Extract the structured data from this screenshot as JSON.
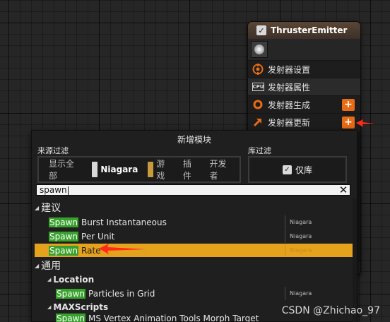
{
  "node": {
    "title": "ThrusterEmitter",
    "enabled_check": "✓",
    "rows": [
      {
        "label": "发射器设置",
        "icon": "emitter-settings-icon",
        "badge": "",
        "has_plus": false
      },
      {
        "label": "发射器属性",
        "icon": "cpu-icon",
        "badge": "CPU",
        "has_plus": false
      },
      {
        "label": "发射器生成",
        "icon": "orange-ring-icon",
        "badge": "",
        "has_plus": true
      },
      {
        "label": "发射器更新",
        "icon": "orange-arrow-icon",
        "badge": "",
        "has_plus": true
      }
    ],
    "plus_glyph": "+"
  },
  "popup": {
    "title": "新增模块",
    "source_filter": {
      "label": "来源过滤",
      "options": [
        {
          "label": "显示全部",
          "active": false,
          "swatch": ""
        },
        {
          "label": "Niagara",
          "active": true,
          "swatch": "#d8d8d8"
        },
        {
          "label": "游戏",
          "active": false,
          "swatch": "#c79a3c"
        },
        {
          "label": "插件",
          "active": false,
          "swatch": ""
        },
        {
          "label": "开发者",
          "active": false,
          "swatch": ""
        }
      ]
    },
    "library_filter": {
      "label": "库过滤",
      "check": "✓",
      "option": "仅库"
    },
    "search": {
      "value": "spawn",
      "clear_glyph": "✕"
    },
    "list": {
      "categories": [
        {
          "name": "建议",
          "items": [
            {
              "match": "Spawn",
              "rest": " Burst Instantaneous",
              "source": "Niagara",
              "selected": false
            },
            {
              "match": "Spawn",
              "rest": " Per Unit",
              "source": "Niagara",
              "selected": false
            },
            {
              "match": "Spawn",
              "rest": " Rate",
              "source": "Niagara",
              "selected": true
            }
          ]
        },
        {
          "name": "通用",
          "subgroups": [
            {
              "name": "Location",
              "items": [
                {
                  "match": "Spawn",
                  "rest": " Particles in Grid",
                  "source": "Niagara",
                  "selected": false
                }
              ]
            },
            {
              "name": "MAXScripts",
              "items": [
                {
                  "match": "Spawn",
                  "rest": " MS Vertex Animation Tools Morph Target",
                  "source": "",
                  "selected": false
                }
              ]
            }
          ]
        }
      ]
    }
  },
  "watermark": "CSDN @Zhichao_97",
  "colors": {
    "accent_orange": "#e86b16",
    "selection": "#e5a21c",
    "match_highlight": "#37a12c",
    "annotation_red": "#ff2a1a"
  }
}
